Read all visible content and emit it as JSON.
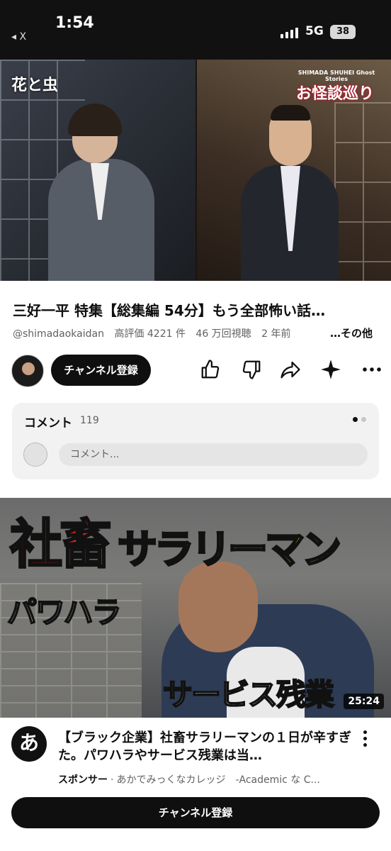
{
  "status_bar": {
    "time": "1:54",
    "back_label": "◂ X",
    "network": "5G",
    "battery": "38"
  },
  "player": {
    "overlay_title": "花と虫",
    "brand_subtitle": "SHIMADA SHUHEI Ghost Stories",
    "brand_title": "お怪談巡り"
  },
  "video": {
    "title": "三好一平 特集【総集編 54分】もう全部怖い話…",
    "channel_handle": "@shimadaokaidan",
    "likes": "高評価 4221 件",
    "views": "46 万回視聴",
    "age": "2 年前",
    "more_label": "…その他",
    "subscribe_label": "チャンネル登録"
  },
  "comments": {
    "label": "コメント",
    "count": "119",
    "placeholder": "コメント..."
  },
  "ad": {
    "thumb_text_red": "社畜",
    "thumb_text_yellow": "サラリーマン",
    "thumb_text_white1": "パワハラ",
    "thumb_text_white2": "サービス残業",
    "duration": "25:24",
    "logo_char": "あ",
    "title": "【ブラック企業】社畜サラリーマンの１日が辛すぎた。パワハラやサービス残業は当…",
    "sponsor_label": "スポンサー",
    "advertiser": "あかでみっくなカレッジ　-Academic な C...",
    "subscribe_label": "チャンネル登録"
  },
  "colors": {
    "accent_dark": "#0f0f0f",
    "secondary_text": "#606060",
    "comment_bg": "#f2f2f2"
  }
}
